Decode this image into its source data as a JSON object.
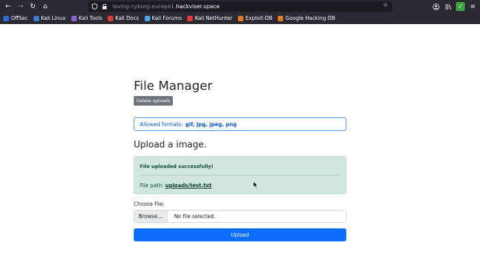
{
  "browser": {
    "url_prefix": "loving-cyborg.europe1.",
    "url_host": "hackviser.space",
    "nav": {
      "back": "←",
      "forward": "→",
      "reload": "↻",
      "home": "⌂"
    },
    "icons": [
      "shield-icon",
      "lock-icon",
      "star-icon",
      "account-icon",
      "extensions-icon",
      "menu-icon"
    ]
  },
  "bookmarks": [
    {
      "label": "OffSec",
      "color": "#2e6bd9"
    },
    {
      "label": "Kali Linux",
      "color": "#3f7ad1"
    },
    {
      "label": "Kali Tools",
      "color": "#8a63d2"
    },
    {
      "label": "Kali Docs",
      "color": "#d93b3b"
    },
    {
      "label": "Kali Forums",
      "color": "#4aa3df"
    },
    {
      "label": "Kali NetHunter",
      "color": "#e03a3a"
    },
    {
      "label": "Exploit-DB",
      "color": "#e07b22"
    },
    {
      "label": "Google Hacking DB",
      "color": "#e07b22"
    }
  ],
  "page": {
    "title": "File Manager",
    "delete_label": "Delete uploads",
    "formats_label": "Allowed formats:",
    "formats_value": "gif, jpg, jpeg, png",
    "section_title": "Upload a image.",
    "alert_head": "File uploaded successfully!",
    "alert_path_label": "File path:",
    "alert_path_link": "uploads/test.txt",
    "choose_label": "Choose File:",
    "browse_label": "Browse…",
    "no_file": "No file selected.",
    "upload_label": "Upload"
  }
}
